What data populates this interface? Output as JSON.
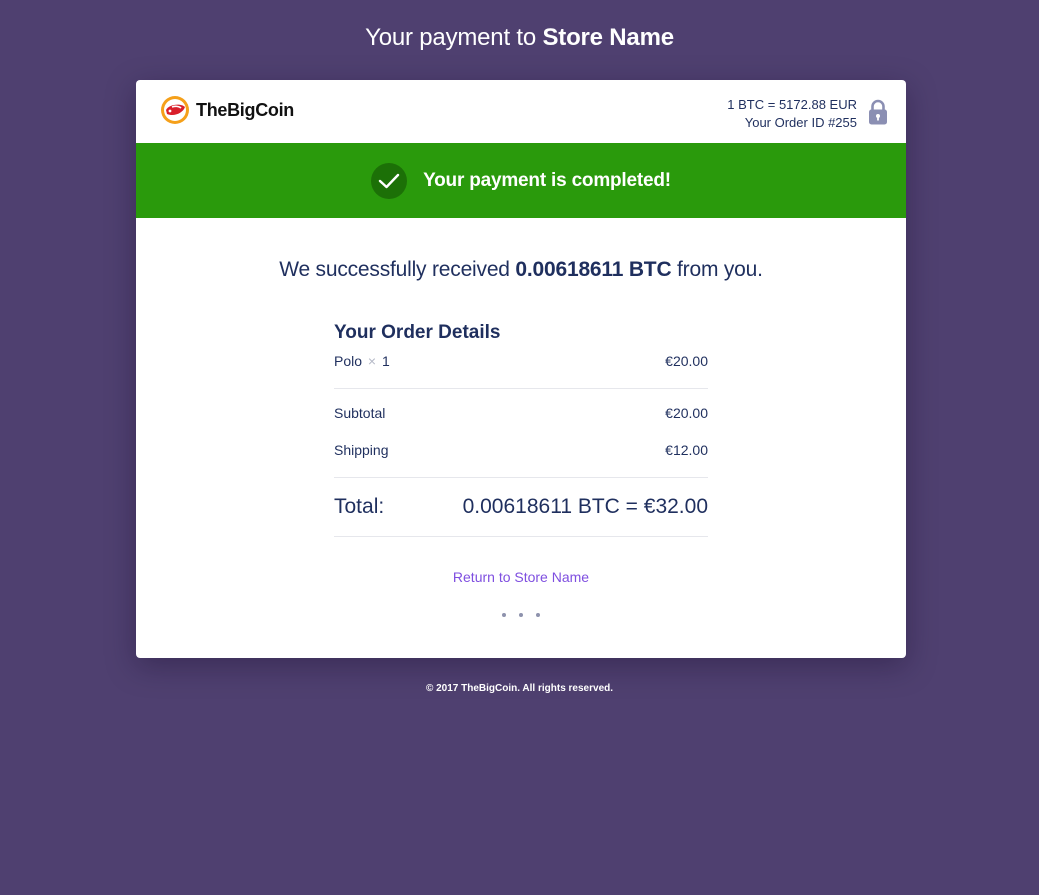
{
  "page": {
    "title_prefix": "Your payment to",
    "store_name": "Store Name"
  },
  "header": {
    "logo_text": "TheBigCoin",
    "rate": "1 BTC = 5172.88 EUR",
    "order_id": "Your Order ID #255"
  },
  "status": {
    "message": "Your payment is completed!"
  },
  "received": {
    "prefix": "We successfully received",
    "amount": "0.00618611 BTC",
    "suffix": "from you."
  },
  "order": {
    "title": "Your Order Details",
    "item": {
      "name": "Polo",
      "qty_sep": "×",
      "qty": "1",
      "price": "€20.00"
    },
    "subtotal": {
      "label": "Subtotal",
      "value": "€20.00"
    },
    "shipping": {
      "label": "Shipping",
      "value": "€12.00"
    },
    "total": {
      "label": "Total:",
      "value": "0.00618611 BTC = €32.00"
    }
  },
  "return_link": "Return to Store Name",
  "footer": "© 2017 TheBigCoin. All rights reserved.",
  "icons": {
    "logo": "thebigcoin-logo-icon",
    "lock": "lock-icon",
    "check": "check-icon"
  },
  "colors": {
    "background": "#4f4070",
    "success": "#2a9a0c",
    "text": "#1f2f5e",
    "link": "#7f4fe0"
  }
}
